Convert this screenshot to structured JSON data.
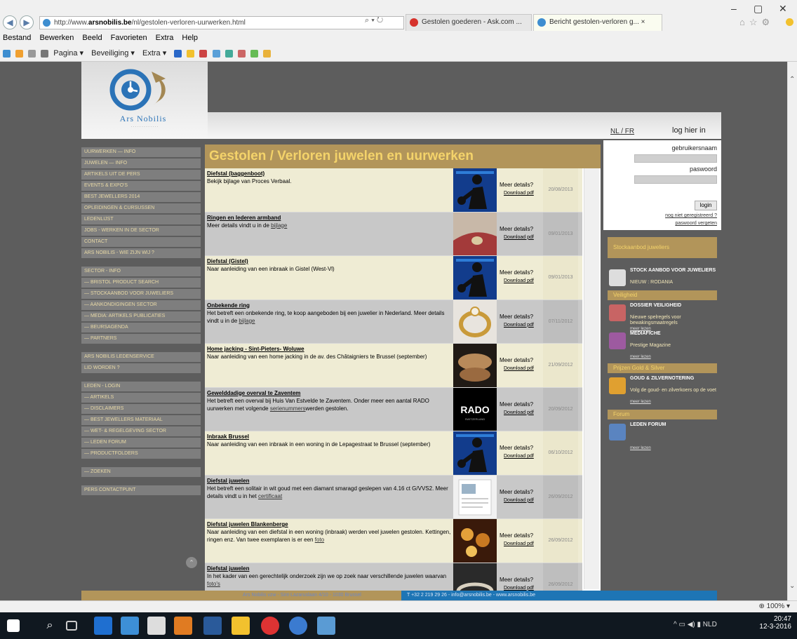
{
  "browser": {
    "url_prefix": "http://www.",
    "url_domain": "arsnobilis.be",
    "url_path": "/nl/gestolen-verloren-uurwerken.html",
    "tabs": [
      {
        "label": "Gestolen goederen - Ask.com ..."
      },
      {
        "label": "Bericht gestolen-verloren g... ×"
      }
    ],
    "menu": [
      "Bestand",
      "Bewerken",
      "Beeld",
      "Favorieten",
      "Extra",
      "Help"
    ],
    "command_bar": [
      "Pagina ▾",
      "Beveiliging ▾",
      "Extra ▾"
    ],
    "zoom": "100%",
    "icons": {
      "back": "back-arrow-icon",
      "forward": "forward-arrow-icon"
    }
  },
  "site": {
    "logo_text": "Ars Nobilis",
    "lang": "NL / FR",
    "login_link": "log hier in",
    "left_nav": [
      "UURWERKEN — INFO",
      "JUWELEN — INFO",
      "ARTIKELS UIT DE PERS",
      "EVENTS & EXPO'S",
      "BEST JEWELLERS 2014",
      "OPLEIDINGEN & CURSUSSEN",
      "LEDENLIJST",
      "JOBS - WERKEN IN DE SECTOR",
      "CONTACT",
      "ARS NOBILIS - WIE ZIJN WIJ ?",
      "",
      "SECTOR - info",
      "— Bristol PRODUCT SEARCH",
      "— STOCKAANBOD voor juweliers",
      "— AANKONDIGINGEN SECTOR",
      "— MEDIA: Artikels PUBLICATIES",
      "— BEURSAGENDA",
      "— PARTNERS",
      "",
      "ARS NOBILIS LEDENSERVICE",
      "LID WORDEN ?",
      "",
      "LEDEN - login",
      "— ARTIKELS",
      "— DISCLAIMERS",
      "— BEST JEWELLERS MATERIAAL",
      "— WET- & REGELGEVING SECTOR",
      "— LEDEN FORUM",
      "— PRODUCTFOLDERS",
      "",
      "— ZOEKEN",
      "",
      "PERS CONTACTPUNT"
    ],
    "main_title": "Gestolen / Verloren juwelen en uurwerken",
    "meer_label": "Meer details?",
    "download_label": "Download pdf",
    "rows": [
      {
        "title": "Diefstal (baggenboot)",
        "desc": "Bekijk bijlage van Proces Verbaal.",
        "link": "",
        "date": "20/08/2013",
        "thumb": "thief"
      },
      {
        "title": "Ringen en lederen armband",
        "desc": "Meer details vindt u in de",
        "link": "bijlage",
        "date": "09/01/2013",
        "thumb": "leather"
      },
      {
        "title": "Diefstal (Gistel)",
        "desc": "Naar aanleiding van een inbraak in Gistel (West-Vl)",
        "link": "",
        "date": "09/01/2013",
        "thumb": "thief"
      },
      {
        "title": "Onbekende ring",
        "desc": "Het betreft een onbekende ring, te koop aangeboden bij een juwelier in Nederland. Meer details vindt u in de",
        "link": "bijlage",
        "date": "07/11/2012",
        "thumb": "ring"
      },
      {
        "title": "Home jacking - Sint-Pieters- Woluwe",
        "desc": "Naar aanleiding van een home jacking in de av. des Châtaigniers te Brussel (september)",
        "link": "",
        "date": "21/09/2012",
        "thumb": "watch"
      },
      {
        "title": "Gewelddadige overval te Zaventem",
        "desc": "Het betreft een overval bij Huis Van Estvelde te Zaventem. Onder meer een aantal RADO uurwerken met volgende",
        "link": "serienummers",
        "desc_after": "werden gestolen.",
        "date": "20/09/2012",
        "thumb": "rado"
      },
      {
        "title": "Inbraak Brussel",
        "desc": "Naar aanleiding van een inbraak in een woning in de Lepagestraat te Brussel (september)",
        "link": "",
        "date": "06/10/2012",
        "thumb": "thief"
      },
      {
        "title": "Diefstal juwelen",
        "desc": "Het betreft een solitair in wit goud met een diamant smaragd geslepen van 4.16 ct G/VVS2. Meer details vindt u in het",
        "link": "certificaat",
        "date": "26/09/2012",
        "thumb": "doc"
      },
      {
        "title": "Diefstal juwelen Blankenberge",
        "desc": "Naar aanleiding van een diefstal in een woning (inbraak) werden veel juwelen gestolen. Kettingen, ringen enz. Van twee exemplaren is er een",
        "link": "foto",
        "date": "26/09/2012",
        "thumb": "jewels"
      },
      {
        "title": "Diefstal juwelen",
        "desc": "In het kader van een gerechtelijk onderzoek zijn we op zoek naar verschillende juwelen waarvan",
        "link": "foto's",
        "date": "26/09/2012",
        "thumb": "bracelet"
      }
    ],
    "login": {
      "user_label": "gebruikersnaam",
      "pass_label": "paswoord",
      "button": "login",
      "register": "nog niet geregistreerd ?",
      "forgot": "paswoord vergeten"
    },
    "right_sections": [
      {
        "title": "Stockaanbod juweliers",
        "ad_title": "STOCK AANBOD VOOR JUWELIERS",
        "ad_sub": "NIEUW : RODANIA",
        "more": "meer lezen"
      },
      {
        "title": "Veiligheid",
        "ad_title": "DOSSIER VEILIGHEID",
        "ad_sub": "Nieuwe spelregels voor bewakingsmaatregels",
        "more": "meer lezen"
      },
      {
        "title": "",
        "ad_title": "MEDIAFICHE",
        "ad_sub": "Prestige Magazine",
        "more": "meer lezen"
      },
      {
        "title": "Prijzen Gold & Silver",
        "ad_title": "GOUD & ZILVERNOTERING",
        "ad_sub": "Volg de goud- en zilverkoers op de voet",
        "more": "meer lezen"
      },
      {
        "title": "Forum",
        "ad_title": "LEDEN FORUM",
        "ad_sub": "",
        "more": "meer lezen"
      }
    ],
    "footer_left": "Ars Nobilis vzw - Sint-Lazaruslaan 4/10 - 1030 Brussel",
    "footer_right": "T +32 2 219 29 26 - info@arsnobilis.be - www.arsnobilis.be"
  },
  "taskbar": {
    "time": "20:47",
    "date": "12-3-2016",
    "lang": "NLD"
  }
}
